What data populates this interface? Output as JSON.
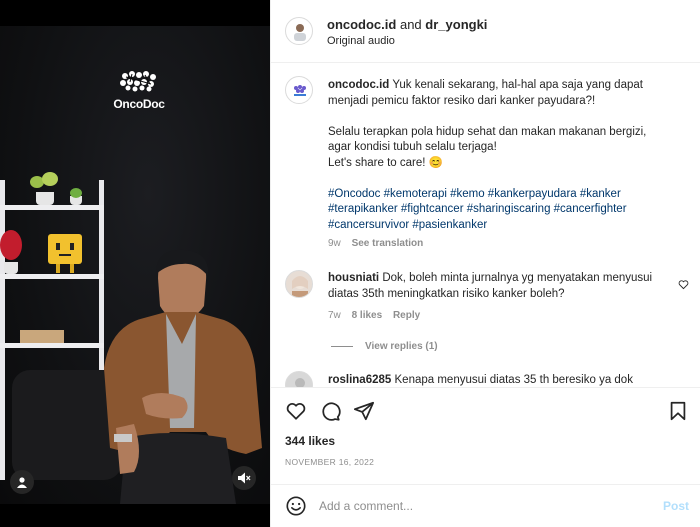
{
  "video": {
    "brand_name": "OncoDoc",
    "icons": {
      "profile": "user-icon",
      "mute": "speaker-muted-icon"
    }
  },
  "header": {
    "user1": "oncodoc.id",
    "connector": "and",
    "user2": "dr_yongki",
    "audio": "Original audio"
  },
  "caption": {
    "username": "oncodoc.id",
    "text1": "Yuk kenali sekarang, hal-hal apa saja yang dapat menjadi pemicu faktor resiko dari kanker payudara?!",
    "text2a": "Selalu terapkan pola hidup sehat dan makan makanan bergizi,",
    "text2b": "agar kondisi tubuh selalu terjaga!",
    "text2c": "Let's share to care! 😊",
    "hashtags_line1": "#Oncodoc #kemoterapi #kemo #kankerpayudara #kanker",
    "hashtags_line2": "#terapikanker #fightcancer #sharingiscaring #cancerfighter",
    "hashtags_line3": "#cancersurvivor #pasienkanker",
    "age": "9w",
    "see_translation": "See translation"
  },
  "comments": [
    {
      "username": "housniati",
      "text": "Dok, boleh minta jurnalnya yg menyatakan menyusui diatas 35th meningkatkan risiko kanker boleh?",
      "age": "7w",
      "likes": "8 likes",
      "reply": "Reply",
      "view_replies": "View replies (1)"
    },
    {
      "username": "roslina6285",
      "text": "Kenapa menyusui diatas 35 th beresiko ya dok"
    }
  ],
  "actions": {
    "icons": [
      "heart-icon",
      "comment-icon",
      "share-icon",
      "bookmark-icon"
    ]
  },
  "likes": "344 likes",
  "date": "NOVEMBER 16, 2022",
  "comment_bar": {
    "placeholder": "Add a comment...",
    "post_label": "Post"
  },
  "colors": {
    "link": "#00376b",
    "muted": "#8e8e8e",
    "post_disabled": "#b2dffc"
  }
}
